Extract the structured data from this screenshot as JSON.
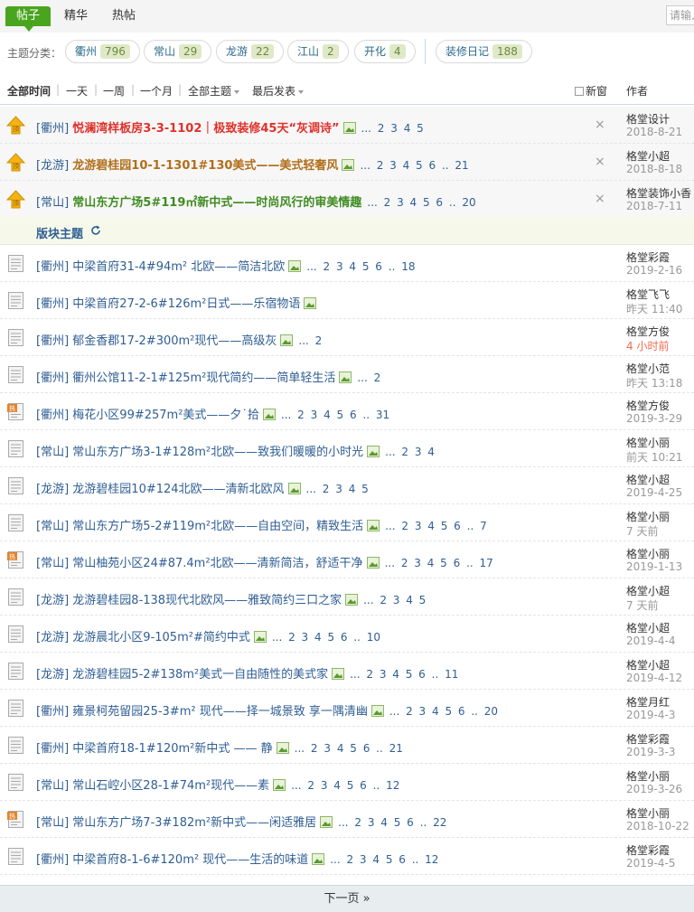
{
  "tabs": [
    {
      "label": "帖子",
      "active": true
    },
    {
      "label": "精华",
      "active": false
    },
    {
      "label": "热帖",
      "active": false
    }
  ],
  "search": {
    "placeholder": "请输入"
  },
  "categories": {
    "label": "主题分类：",
    "items": [
      {
        "name": "衢州",
        "count": "796"
      },
      {
        "name": "常山",
        "count": "29"
      },
      {
        "name": "龙游",
        "count": "22"
      },
      {
        "name": "江山",
        "count": "2"
      },
      {
        "name": "开化",
        "count": "4"
      },
      {
        "name": "装修日记",
        "count": "188"
      }
    ]
  },
  "filters": {
    "all_time": "全部时间",
    "day": "一天",
    "week": "一周",
    "month": "一个月",
    "all_topics": "全部主题",
    "latest": "最后发表",
    "sep": "|",
    "new_window": "新窗",
    "author_header": "作者"
  },
  "colors": {
    "accent": "#4aa51e",
    "link": "#2f5e93"
  },
  "pinned": [
    {
      "tag": "[衢州]",
      "title": "悦澜湾样板房3-3-1102｜极致装修45天“灰调诗”",
      "style": "red",
      "pages": "... 2 3 4 5",
      "author": "格堂设计",
      "date": "2018-8-21",
      "icon": "pin-icon"
    },
    {
      "tag": "[龙游]",
      "title": "龙游碧桂园10-1-1301#130美式——美式轻奢风",
      "style": "brown",
      "pages": "... 2 3 4 5 6 .. 21",
      "author": "格堂小超",
      "date": "2018-8-18",
      "icon": "pin-icon"
    },
    {
      "tag": "[常山]",
      "title": "常山东方广场5#119㎡新中式——时尚风行的审美情趣",
      "style": "green",
      "pages": "... 2 3 4 5 6 .. 20",
      "author": "格堂装饰小香",
      "date": "2018-7-11",
      "icon": "pin-icon"
    }
  ],
  "close_label": "×",
  "section": {
    "title": "版块主题"
  },
  "threads": [
    {
      "tag": "[衢州]",
      "title": "中梁首府31-4#94m² 北欧——简洁北欧",
      "pages": "... 2 3 4 5 6 .. 18",
      "author": "格堂彩霞",
      "date": "2019-2-16",
      "hot": false,
      "recent": false
    },
    {
      "tag": "[衢州]",
      "title": "中梁首府27-2-6#126m²日式——乐宿物语",
      "pages": "",
      "author": "格堂飞飞",
      "date": "昨天 11:40",
      "hot": false,
      "recent": false
    },
    {
      "tag": "[衢州]",
      "title": "郁金香郡17-2#300m²现代——高级灰",
      "pages": "... 2",
      "author": "格堂方俊",
      "date": "4 小时前",
      "hot": false,
      "recent": true
    },
    {
      "tag": "[衢州]",
      "title": "衢州公馆11-2-1#125m²现代简约——简单轻生活",
      "pages": "... 2",
      "author": "格堂小范",
      "date": "昨天 13:18",
      "hot": false,
      "recent": false
    },
    {
      "tag": "[衢州]",
      "title": "梅花小区99#257m²美式——夕˙拾",
      "pages": "... 2 3 4 5 6 .. 31",
      "author": "格堂方俊",
      "date": "2019-3-29",
      "hot": true,
      "recent": false
    },
    {
      "tag": "[常山]",
      "title": "常山东方广场3-1#128m²北欧——致我们暖暖的小时光",
      "pages": "... 2 3 4",
      "author": "格堂小丽",
      "date": "前天 10:21",
      "hot": false,
      "recent": false
    },
    {
      "tag": "[龙游]",
      "title": "龙游碧桂园10#124北欧——清新北欧风",
      "pages": "... 2 3 4 5",
      "author": "格堂小超",
      "date": "2019-4-25",
      "hot": false,
      "recent": false
    },
    {
      "tag": "[常山]",
      "title": "常山东方广场5-2#119m²北欧——自由空间，精致生活",
      "pages": "... 2 3 4 5 6 .. 7",
      "author": "格堂小丽",
      "date": "7 天前",
      "hot": false,
      "recent": false
    },
    {
      "tag": "[常山]",
      "title": "常山柚苑小区24#87.4m²北欧——清新简洁，舒适干净",
      "pages": "... 2 3 4 5 6 .. 17",
      "author": "格堂小丽",
      "date": "2019-1-13",
      "hot": true,
      "recent": false
    },
    {
      "tag": "[龙游]",
      "title": "龙游碧桂园8-138现代北欧风——雅致简约三口之家",
      "pages": "... 2 3 4 5",
      "author": "格堂小超",
      "date": "7 天前",
      "hot": false,
      "recent": false
    },
    {
      "tag": "[龙游]",
      "title": "龙游晨北小区9-105m²#简约中式",
      "pages": "... 2 3 4 5 6 .. 10",
      "author": "格堂小超",
      "date": "2019-4-4",
      "hot": false,
      "recent": false
    },
    {
      "tag": "[龙游]",
      "title": "龙游碧桂园5-2#138m²美式一自由随性的美式家",
      "pages": "... 2 3 4 5 6 .. 11",
      "author": "格堂小超",
      "date": "2019-4-12",
      "hot": false,
      "recent": false
    },
    {
      "tag": "[衢州]",
      "title": "雍景柯苑留园25-3#m² 现代——择一城景致 享一隅清幽",
      "pages": "... 2 3 4 5 6 .. 20",
      "author": "格堂月红",
      "date": "2019-4-3",
      "hot": false,
      "recent": false
    },
    {
      "tag": "[衢州]",
      "title": "中梁首府18-1#120m²新中式 —— 静",
      "pages": "... 2 3 4 5 6 .. 21",
      "author": "格堂彩霞",
      "date": "2019-3-3",
      "hot": false,
      "recent": false
    },
    {
      "tag": "[常山]",
      "title": "常山石崆小区28-1#74m²现代——素",
      "pages": "... 2 3 4 5 6 .. 12",
      "author": "格堂小丽",
      "date": "2019-3-26",
      "hot": false,
      "recent": false
    },
    {
      "tag": "[常山]",
      "title": "常山东方广场7-3#182m²新中式——闲适雅居",
      "pages": "... 2 3 4 5 6 .. 22",
      "author": "格堂小丽",
      "date": "2018-10-22",
      "hot": true,
      "recent": false
    },
    {
      "tag": "[衢州]",
      "title": "中梁首府8-1-6#120m² 现代——生活的味道",
      "pages": "... 2 3 4 5 6 .. 12",
      "author": "格堂彩霞",
      "date": "2019-4-5",
      "hot": false,
      "recent": false
    }
  ],
  "pager": {
    "next": "下一页 »"
  }
}
